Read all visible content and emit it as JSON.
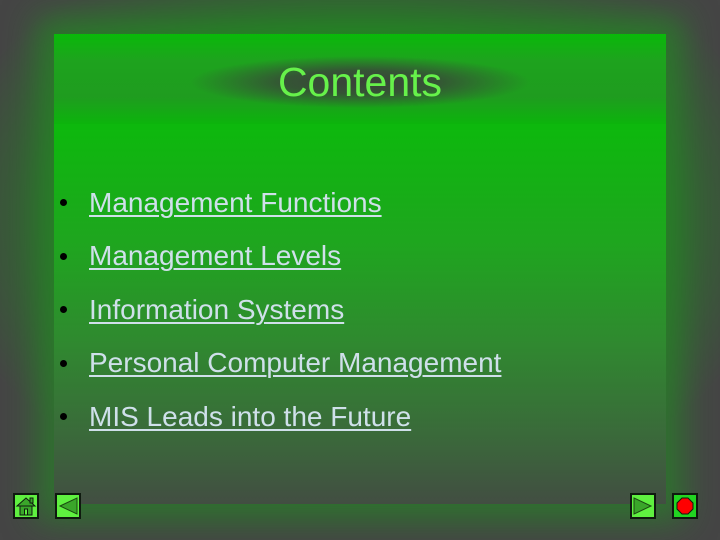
{
  "slide": {
    "title": "Contents",
    "items": [
      {
        "label": "Management Functions"
      },
      {
        "label": "Management Levels"
      },
      {
        "label": "Information Systems"
      },
      {
        "label": "Personal Computer Management"
      },
      {
        "label": "MIS Leads into the Future"
      }
    ]
  },
  "navigation": {
    "home": {
      "icon": "home-icon"
    },
    "back": {
      "icon": "triangle-left-icon"
    },
    "next": {
      "icon": "triangle-right-icon"
    },
    "end": {
      "icon": "stop-octagon-icon"
    }
  },
  "colors": {
    "background": "#454545",
    "slide_green": "#0cbc0c",
    "title_text": "#66f24a",
    "link_text": "#cfe0ea",
    "button_face": "#5ff040",
    "stop_red": "#ff0000"
  }
}
